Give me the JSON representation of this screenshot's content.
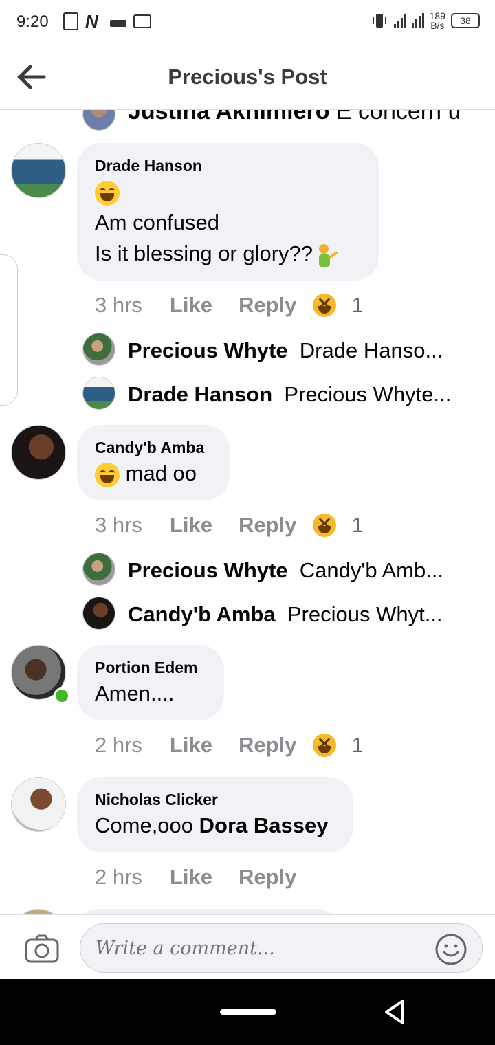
{
  "status_bar": {
    "time": "9:20",
    "net_speed_value": "189",
    "net_speed_unit": "B/s",
    "battery": "38",
    "icons": [
      "battery-saver-icon",
      "n-app-icon",
      "bar-icon",
      "mail-icon",
      "vibrate-icon",
      "signal-icon",
      "signal-h-icon"
    ]
  },
  "header": {
    "title": "Precious's Post",
    "back_icon": "arrow-left-icon"
  },
  "top_partial": {
    "name": "Justina Akhimiero",
    "text": "E concern u"
  },
  "comments": [
    {
      "name": "Drade Hanson",
      "lines": [
        "Am confused",
        "Is it blessing or glory??"
      ],
      "time": "3 hrs",
      "like": "Like",
      "reply": "Reply",
      "reaction_count": "1",
      "replies": [
        {
          "name": "Precious Whyte",
          "preview": "Drade Hanso..."
        },
        {
          "name": "Drade Hanson",
          "preview": "Precious Whyte..."
        }
      ]
    },
    {
      "name": "Candy'b Amba",
      "text": "mad oo",
      "time": "3 hrs",
      "like": "Like",
      "reply": "Reply",
      "reaction_count": "1",
      "replies": [
        {
          "name": "Precious Whyte",
          "preview": "Candy'b Amb..."
        },
        {
          "name": "Candy'b Amba",
          "preview": "Precious Whyt..."
        }
      ]
    },
    {
      "name": "Portion Edem",
      "text": "Amen....",
      "time": "2 hrs",
      "like": "Like",
      "reply": "Reply",
      "reaction_count": "1"
    },
    {
      "name": "Nicholas Clicker",
      "text_prefix": "Come,ooo",
      "mention": "Dora Bassey",
      "time": "2 hrs",
      "like": "Like",
      "reply": "Reply"
    }
  ],
  "composer": {
    "placeholder": "Write a comment...",
    "camera_icon": "camera-icon",
    "emoji_icon": "smiley-icon"
  },
  "colors": {
    "bubble": "#f0f2f5",
    "meta_text": "#8a8d91",
    "online": "#42b72a",
    "reaction": "#f7b928"
  }
}
